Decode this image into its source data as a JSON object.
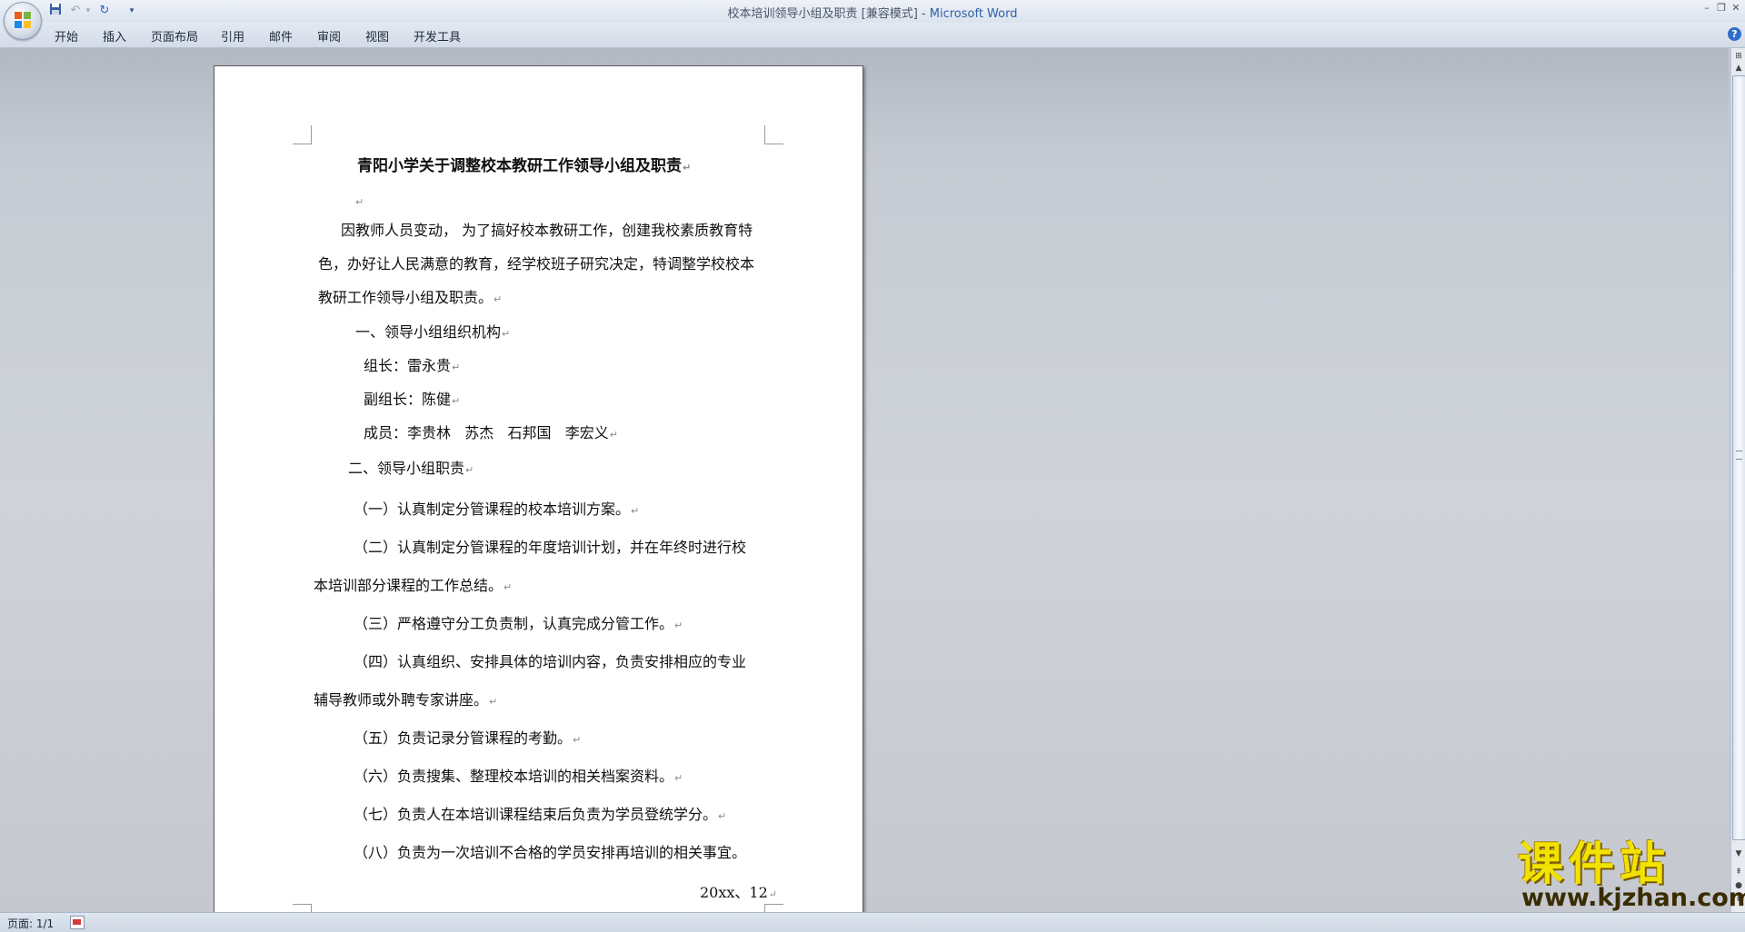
{
  "window": {
    "title": "校本培训领导小组及职责 [兼容模式] - ",
    "app_name": "Microsoft Word"
  },
  "ribbon": {
    "tabs": [
      "开始",
      "插入",
      "页面布局",
      "引用",
      "邮件",
      "审阅",
      "视图",
      "开发工具"
    ]
  },
  "document": {
    "title": "青阳小学关于调整校本教研工作领导小组及职责",
    "lines": [
      "因教师人员变动， 为了搞好校本教研工作，创建我校素质教育特",
      "色，办好让人民满意的教育，经学校班子研究决定，特调整学校校本",
      "教研工作领导小组及职责。",
      "一、领导小组组织机构",
      "组长：雷永贵",
      "副组长：陈健",
      "成员：李贵林   苏杰   石邦国   李宏义",
      "二、领导小组职责",
      "（一）认真制定分管课程的校本培训方案。",
      "（二）认真制定分管课程的年度培训计划，并在年终时进行校",
      "本培训部分课程的工作总结。",
      "（三）严格遵守分工负责制，认真完成分管工作。",
      "（四）认真组织、安排具体的培训内容，负责安排相应的专业",
      "辅导教师或外聘专家讲座。",
      "（五）负责记录分管课程的考勤。",
      "（六）负责搜集、整理校本培训的相关档案资料。",
      "（七）负责人在本培训课程结束后负责为学员登统学分。",
      "（八）负责为一次培训不合格的学员安排再培训的相关事宜。",
      "20xx、12"
    ]
  },
  "statusbar": {
    "page": "页面: 1/1"
  },
  "watermark": {
    "text": "课件站",
    "url": "www.kjzhan.com"
  }
}
